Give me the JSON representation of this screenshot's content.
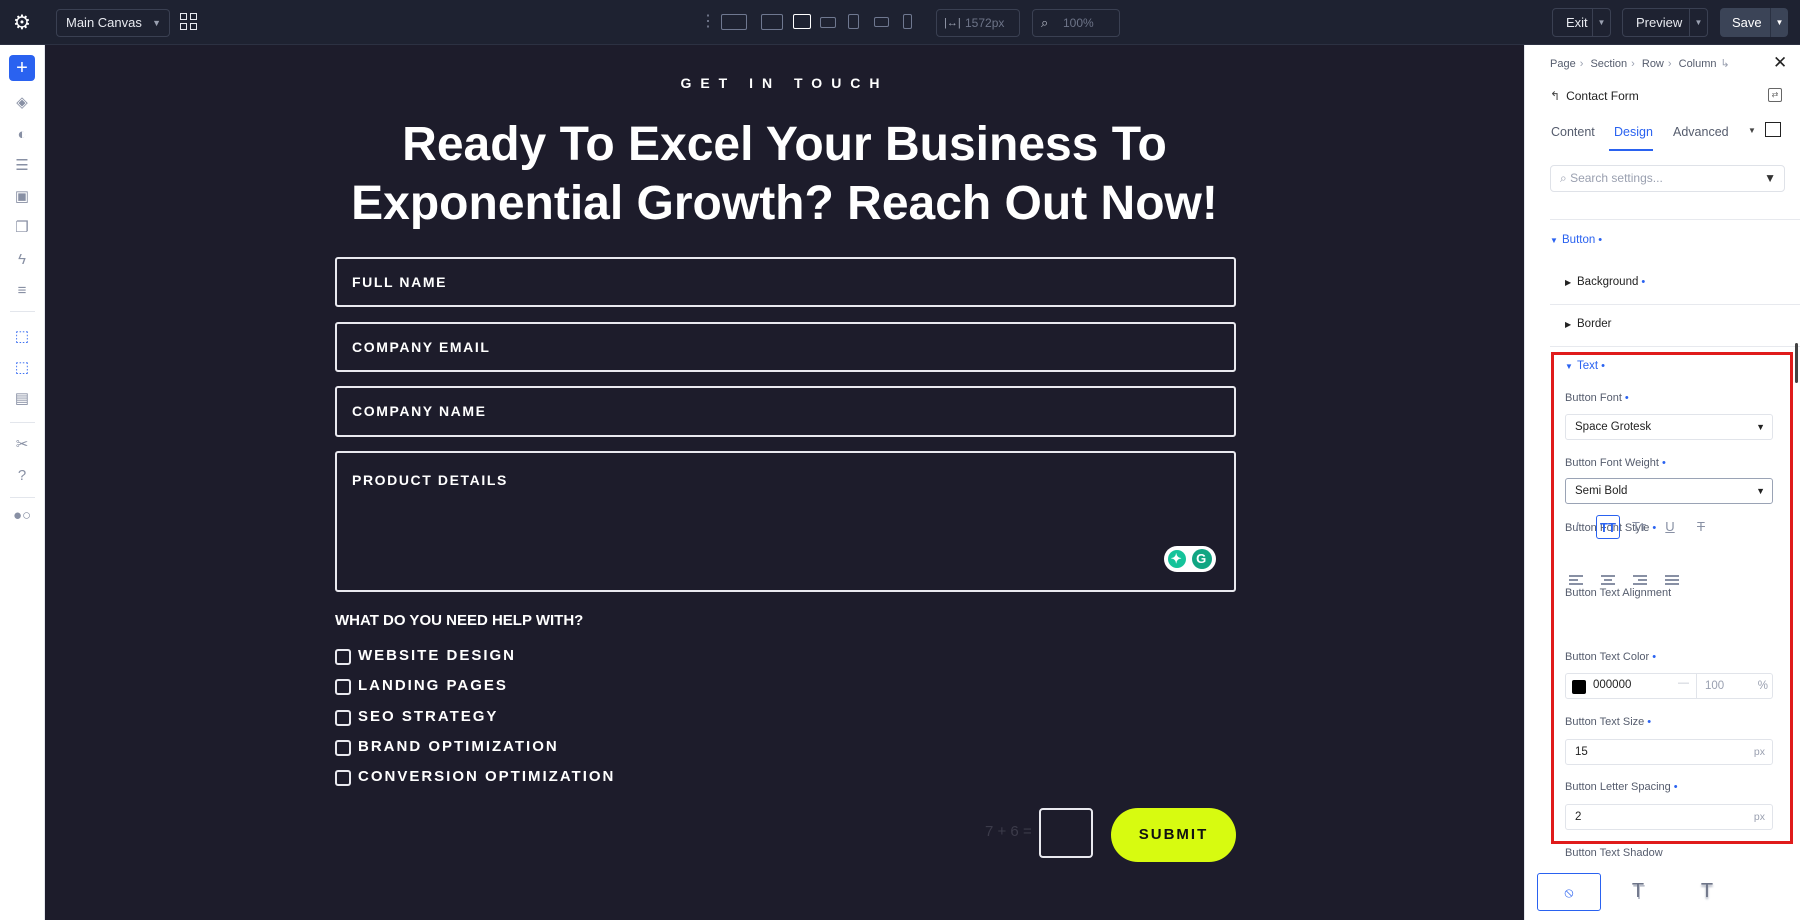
{
  "toolbar": {
    "canvas_select": "Main Canvas",
    "width_value": "1572px",
    "zoom_value": "100%",
    "exit_label": "Exit",
    "preview_label": "Preview",
    "save_label": "Save"
  },
  "canvas": {
    "eyebrow": "GET IN TOUCH",
    "headline_line1": "Ready To Excel Your Business To",
    "headline_line2": "Exponential Growth? Reach Out Now!",
    "fields": [
      "FULL NAME",
      "COMPANY EMAIL",
      "COMPANY NAME",
      "PRODUCT DETAILS"
    ],
    "help_question": "WHAT DO YOU NEED HELP WITH?",
    "checkboxes": [
      "WEBSITE DESIGN",
      "LANDING PAGES",
      "SEO STRATEGY",
      "BRAND OPTIMIZATION",
      "CONVERSION OPTIMIZATION"
    ],
    "captcha": "7 + 6 =",
    "submit_label": "SUBMIT"
  },
  "panel": {
    "breadcrumb": [
      "Page",
      "Section",
      "Row",
      "Column"
    ],
    "element_title": "Contact Form",
    "tabs": [
      "Content",
      "Design",
      "Advanced"
    ],
    "active_tab": "Design",
    "search_placeholder": "Search settings...",
    "section_button": "Button",
    "sub_background": "Background",
    "sub_border": "Border",
    "sub_text": "Text",
    "font_label": "Button Font",
    "font_value": "Space Grotesk",
    "weight_label": "Button Font Weight",
    "weight_value": "Semi Bold",
    "style_label": "Button Font Style",
    "style_options": [
      "I",
      "TT",
      "Tт",
      "U",
      "T"
    ],
    "alignment_label": "Button Text Alignment",
    "color_label": "Button Text Color",
    "color_hex": "000000",
    "color_dash": "—",
    "color_opacity": "100",
    "color_opacity_unit": "%",
    "size_label": "Button Text Size",
    "size_value": "15",
    "size_unit": "px",
    "spacing_label": "Button Letter Spacing",
    "spacing_value": "2",
    "spacing_unit": "px",
    "shadow_label": "Button Text Shadow"
  },
  "colors": {
    "accent": "#2a62f0",
    "submit": "#d7fb10",
    "canvas_bg": "#1d1c2b",
    "highlight": "#e01b1b"
  },
  "icons": {
    "settings": "gear-icon",
    "add": "plus-icon",
    "close": "close-icon",
    "search": "search-icon",
    "filter": "filter-icon"
  }
}
